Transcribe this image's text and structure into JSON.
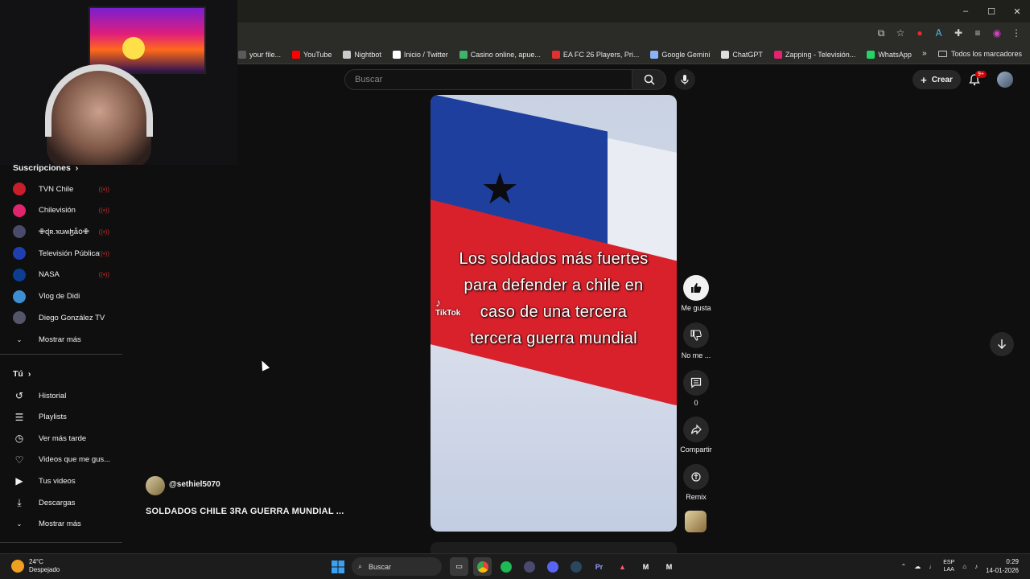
{
  "window": {
    "minimize": "–",
    "maximize": "☐",
    "close": "✕"
  },
  "bookmarks": [
    {
      "label": "your file...",
      "color": "#5a5a5a"
    },
    {
      "label": "YouTube",
      "color": "#ff0000"
    },
    {
      "label": "Nightbot",
      "color": "#cccccc"
    },
    {
      "label": "Inicio / Twitter",
      "color": "#ffffff"
    },
    {
      "label": "Casino online, apue...",
      "color": "#3fb26b"
    },
    {
      "label": "EA FC 26 Players, Pri...",
      "color": "#e03030"
    },
    {
      "label": "Google Gemini",
      "color": "#8ab4f8"
    },
    {
      "label": "ChatGPT",
      "color": "#dddddd"
    },
    {
      "label": "Zapping - Televisión...",
      "color": "#e0246e"
    },
    {
      "label": "WhatsApp",
      "color": "#25d366"
    }
  ],
  "bookmarks_all": "Todos los marcadores",
  "masthead": {
    "search_placeholder": "Buscar",
    "create_label": "Crear",
    "notifications_badge": "9+"
  },
  "sidebar": {
    "subscriptions_title": "Suscripciones",
    "subscriptions": [
      {
        "name": "TVN Chile",
        "live": true,
        "color": "#c81e2b"
      },
      {
        "name": "Chilevisión",
        "live": true,
        "color": "#e0246e"
      },
      {
        "name": "✙ɖʀ.ҡʊʍɮǟօ✙",
        "live": true,
        "color": "#4a4a6a"
      },
      {
        "name": "Televisión Pública",
        "live": true,
        "color": "#1f3fb0"
      },
      {
        "name": "NASA",
        "live": true,
        "color": "#0b3d91"
      },
      {
        "name": "Vlog de Didi",
        "live": false,
        "color": "#3d8fd4"
      },
      {
        "name": "Diego González TV",
        "live": false,
        "color": "#55556a"
      }
    ],
    "show_more_1": "Mostrar más",
    "you_title": "Tú",
    "you_items": [
      {
        "label": "Historial",
        "icon": "history-icon"
      },
      {
        "label": "Playlists",
        "icon": "playlists-icon"
      },
      {
        "label": "Ver más tarde",
        "icon": "watch-later-icon"
      },
      {
        "label": "Videos que me gus...",
        "icon": "liked-videos-icon"
      },
      {
        "label": "Tus videos",
        "icon": "your-videos-icon"
      },
      {
        "label": "Descargas",
        "icon": "downloads-icon"
      }
    ],
    "show_more_2": "Mostrar más"
  },
  "video": {
    "caption_lines": [
      "Los soldados más fuertes",
      "para defender a chile en",
      "caso de una tercera",
      "tercera guerra mundial"
    ],
    "tiktok": "TikTok",
    "channel": "@sethiel5070",
    "title": "SOLDADOS CHILE 3RA GUERRA MUNDIAL ..."
  },
  "actions": {
    "like": "Me gusta",
    "dislike": "No me ...",
    "comments": "0",
    "share": "Compartir",
    "remix": "Remix"
  },
  "taskbar": {
    "temperature": "24°C",
    "weather": "Despejado",
    "search": "Buscar",
    "lang_1": "ESP",
    "lang_2": "LAA",
    "time": "0:29",
    "date": "14-01-2026"
  }
}
